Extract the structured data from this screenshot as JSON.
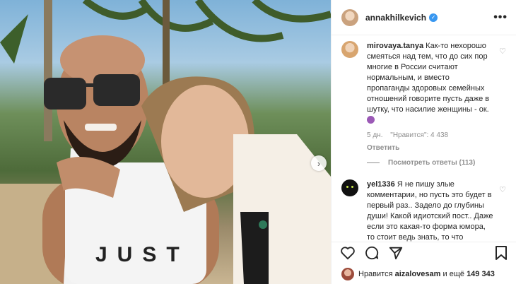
{
  "header": {
    "username": "annakhilkevich",
    "more_label": "•••"
  },
  "photo": {
    "shirt_text_line1": "JUST"
  },
  "comments": [
    {
      "user": "mirovaya.tanya",
      "text": "Как-то нехорошо смеяться над тем, что до сих пор многие в России считают нормальным, и вместо пропаганды здоровых семейных отношений говорите пусть даже в шутку, что насилие женщины - ок.",
      "age": "5 дн.",
      "likes": "\"Нравится\": 4 438",
      "reply_label": "Ответить",
      "view_replies": "Посмотреть ответы (113)"
    },
    {
      "user": "yel1336",
      "text": "Я не пишу злые комментарии, но пусть это будет в первый раз.. Задело до глубины души! Какой идиотский пост.. Даже если это какая-то форма юмора, то стоит ведь знать, то что публичном"
    }
  ],
  "likes_bar": {
    "prefix": "Нравится",
    "user": "aizalovesam",
    "suffix": "и ещё",
    "count": "149 343"
  },
  "colors": {
    "verified": "#3897f0",
    "text": "#262626",
    "muted": "#8e8e8e"
  }
}
